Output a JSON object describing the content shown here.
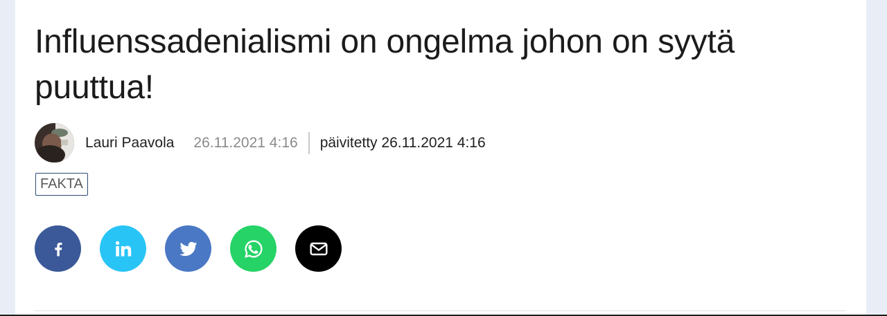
{
  "article": {
    "title": "Influenssadenialismi on ongelma johon on syytä puuttua!",
    "author": "Lauri Paavola",
    "published": "26.11.2021 4:16",
    "updated": "päivitetty 26.11.2021 4:16",
    "tag": "FAKTA"
  },
  "share": {
    "buttons": [
      {
        "network": "facebook",
        "icon": "facebook-icon",
        "color": "#3b5998"
      },
      {
        "network": "linkedin",
        "icon": "linkedin-icon",
        "color": "#29c4f6"
      },
      {
        "network": "twitter",
        "icon": "twitter-icon",
        "color": "#4a78c4"
      },
      {
        "network": "whatsapp",
        "icon": "whatsapp-icon",
        "color": "#25d366"
      },
      {
        "network": "email",
        "icon": "envelope-icon",
        "color": "#000000"
      }
    ]
  },
  "colors": {
    "page_background": "#e9eef6",
    "card_background": "#ffffff",
    "tag_border": "#2d4a73"
  }
}
